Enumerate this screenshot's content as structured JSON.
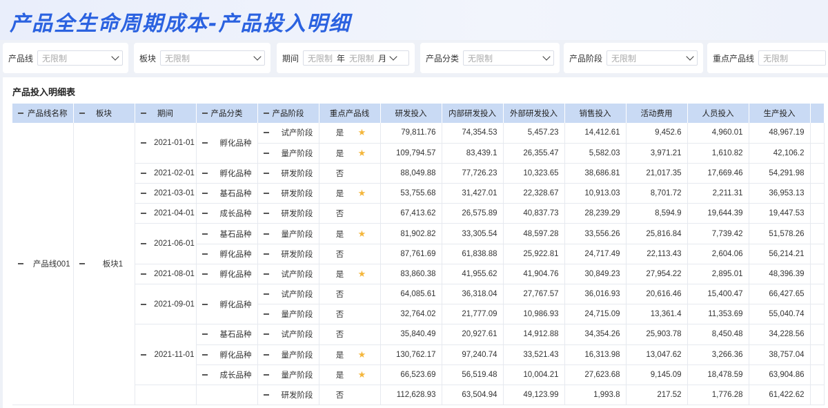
{
  "page": {
    "title": "产品全生命周期成本-产品投入明细"
  },
  "filters": [
    {
      "label": "产品线",
      "placeholder": "无限制"
    },
    {
      "label": "板块",
      "placeholder": "无限制"
    },
    {
      "label": "期间",
      "year_placeholder": "无限制",
      "year_unit": "年",
      "month_placeholder": "无限制",
      "month_unit": "月"
    },
    {
      "label": "产品分类",
      "placeholder": "无限制"
    },
    {
      "label": "产品阶段",
      "placeholder": "无限制"
    },
    {
      "label": "重点产品线",
      "placeholder": "无限制"
    }
  ],
  "table": {
    "title": "产品投入明细表",
    "headers": [
      "产品线名称",
      "板块",
      "期间",
      "产品分类",
      "产品阶段",
      "重点产品线",
      "研发投入",
      "内部研发投入",
      "外部研发投入",
      "销售投入",
      "活动费用",
      "人员投入",
      "生产投入"
    ],
    "product_line": "产品线001",
    "segment": "板块1",
    "rows": [
      {
        "period": "2021-01-01",
        "category": "孵化品种",
        "stage": "试产阶段",
        "key": "是",
        "star": true,
        "rd": "79,811.76",
        "rd_in": "74,354.53",
        "rd_out": "5,457.23",
        "sales": "14,412.61",
        "activity": "9,452.6",
        "staff": "4,960.01",
        "prod": "48,967.19"
      },
      {
        "period": "",
        "category": "",
        "stage": "量产阶段",
        "key": "是",
        "star": true,
        "rd": "109,794.57",
        "rd_in": "83,439.1",
        "rd_out": "26,355.47",
        "sales": "5,582.03",
        "activity": "3,971.21",
        "staff": "1,610.82",
        "prod": "42,106.2"
      },
      {
        "period": "2021-02-01",
        "category": "孵化品种",
        "stage": "研发阶段",
        "key": "否",
        "star": false,
        "rd": "88,049.88",
        "rd_in": "77,726.23",
        "rd_out": "10,323.65",
        "sales": "38,686.81",
        "activity": "21,017.35",
        "staff": "17,669.46",
        "prod": "54,291.98"
      },
      {
        "period": "2021-03-01",
        "category": "基石品种",
        "stage": "研发阶段",
        "key": "是",
        "star": true,
        "rd": "53,755.68",
        "rd_in": "31,427.01",
        "rd_out": "22,328.67",
        "sales": "10,913.03",
        "activity": "8,701.72",
        "staff": "2,211.31",
        "prod": "36,953.13"
      },
      {
        "period": "2021-04-01",
        "category": "成长品种",
        "stage": "研发阶段",
        "key": "否",
        "star": false,
        "rd": "67,413.62",
        "rd_in": "26,575.89",
        "rd_out": "40,837.73",
        "sales": "28,239.29",
        "activity": "8,594.9",
        "staff": "19,644.39",
        "prod": "19,447.53"
      },
      {
        "period": "2021-06-01",
        "category": "基石品种",
        "stage": "量产阶段",
        "key": "是",
        "star": true,
        "rd": "81,902.82",
        "rd_in": "33,305.54",
        "rd_out": "48,597.28",
        "sales": "33,556.26",
        "activity": "25,816.84",
        "staff": "7,739.42",
        "prod": "51,578.26"
      },
      {
        "period": "",
        "category": "孵化品种",
        "stage": "研发阶段",
        "key": "否",
        "star": false,
        "rd": "87,761.69",
        "rd_in": "61,838.88",
        "rd_out": "25,922.81",
        "sales": "24,717.49",
        "activity": "22,113.43",
        "staff": "2,604.06",
        "prod": "56,214.21"
      },
      {
        "period": "2021-08-01",
        "category": "孵化品种",
        "stage": "试产阶段",
        "key": "是",
        "star": true,
        "rd": "83,860.38",
        "rd_in": "41,955.62",
        "rd_out": "41,904.76",
        "sales": "30,849.23",
        "activity": "27,954.22",
        "staff": "2,895.01",
        "prod": "48,396.39"
      },
      {
        "period": "2021-09-01",
        "category": "孵化品种",
        "stage": "试产阶段",
        "key": "否",
        "star": false,
        "rd": "64,085.61",
        "rd_in": "36,318.04",
        "rd_out": "27,767.57",
        "sales": "36,016.93",
        "activity": "20,616.46",
        "staff": "15,400.47",
        "prod": "66,427.65"
      },
      {
        "period": "",
        "category": "",
        "stage": "量产阶段",
        "key": "否",
        "star": false,
        "rd": "32,764.02",
        "rd_in": "21,777.09",
        "rd_out": "10,986.93",
        "sales": "24,715.09",
        "activity": "13,361.4",
        "staff": "11,353.69",
        "prod": "55,040.74"
      },
      {
        "period": "2021-11-01",
        "category": "基石品种",
        "stage": "试产阶段",
        "key": "否",
        "star": false,
        "rd": "35,840.49",
        "rd_in": "20,927.61",
        "rd_out": "14,912.88",
        "sales": "34,354.26",
        "activity": "25,903.78",
        "staff": "8,450.48",
        "prod": "34,228.56"
      },
      {
        "period": "",
        "category": "孵化品种",
        "stage": "量产阶段",
        "key": "是",
        "star": true,
        "rd": "130,762.17",
        "rd_in": "97,240.74",
        "rd_out": "33,521.43",
        "sales": "16,313.98",
        "activity": "13,047.62",
        "staff": "3,266.36",
        "prod": "38,757.04"
      },
      {
        "period": "",
        "category": "成长品种",
        "stage": "量产阶段",
        "key": "是",
        "star": true,
        "rd": "66,523.69",
        "rd_in": "56,519.48",
        "rd_out": "10,004.21",
        "sales": "27,623.68",
        "activity": "9,145.09",
        "staff": "18,478.59",
        "prod": "63,904.86"
      },
      {
        "period": "",
        "category": "",
        "stage": "研发阶段",
        "key": "否",
        "star": false,
        "rd": "112,628.93",
        "rd_in": "63,504.94",
        "rd_out": "49,123.99",
        "sales": "1,993.8",
        "activity": "217.52",
        "staff": "1,776.28",
        "prod": "61,422.62"
      }
    ]
  }
}
